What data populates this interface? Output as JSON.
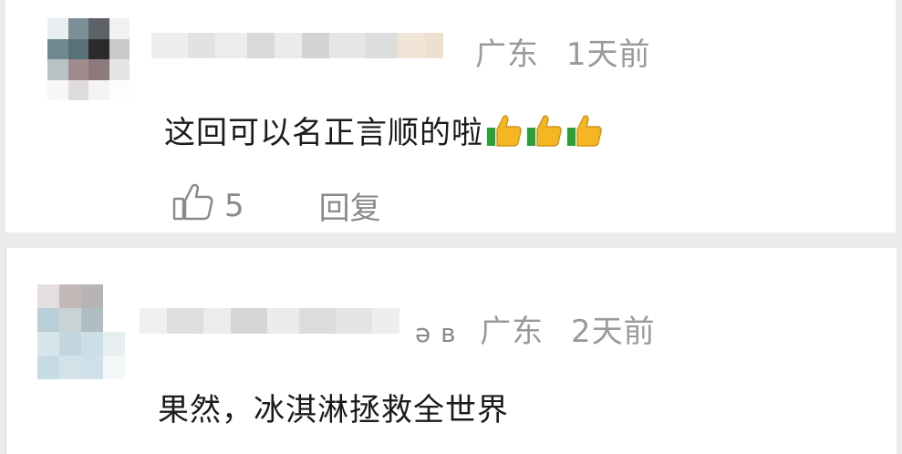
{
  "comments": [
    {
      "location": "广东",
      "time": "1天前",
      "text": "这回可以名正言顺的啦",
      "emojis": [
        "thumbs-up",
        "thumbs-up",
        "thumbs-up"
      ],
      "like_count": "5",
      "reply_label": "回复"
    },
    {
      "location": "广东",
      "time": "2天前",
      "name_suffix": "ə ʙ",
      "text": "果然，冰淇淋拯救全世界"
    }
  ]
}
